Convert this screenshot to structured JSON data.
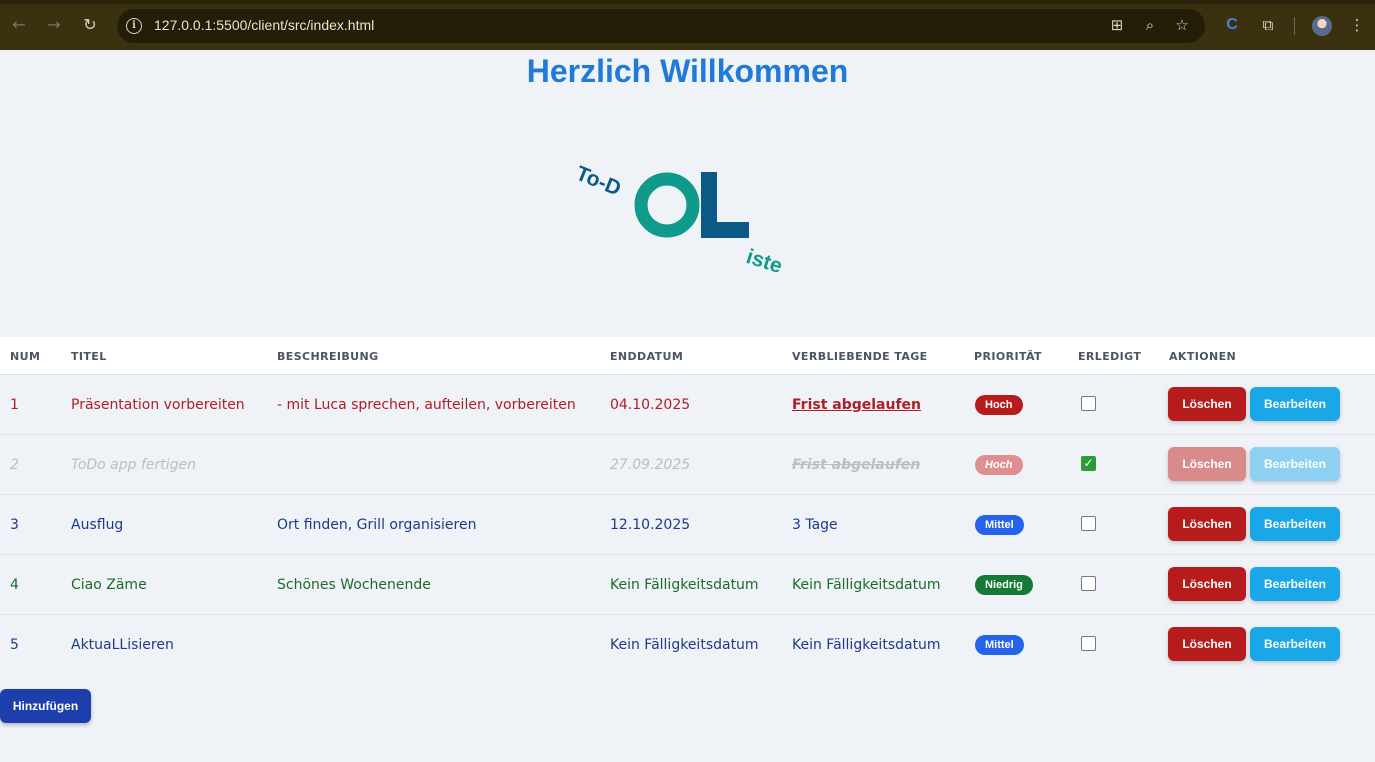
{
  "browser": {
    "url": "127.0.0.1:5500/client/src/index.html"
  },
  "page": {
    "title": "Herzlich Willkommen",
    "logo": {
      "left_text": "To-D",
      "big_text_o": "O",
      "big_text_l": "L",
      "right_text": "iste",
      "colors": {
        "teal": "#0f9a8c",
        "navy": "#0b5a86"
      }
    }
  },
  "table": {
    "headers": {
      "num": "NUM",
      "title": "TITEL",
      "desc": "BESCHREIBUNG",
      "due": "ENDDATUM",
      "remaining": "VERBLIEBENDE TAGE",
      "priority": "PRIORITÄT",
      "done": "ERLEDIGT",
      "actions": "AKTIONEN"
    },
    "rows": [
      {
        "num": "1",
        "title": "Präsentation vorbereiten",
        "desc": "- mit Luca sprechen, aufteilen, vorbereiten",
        "due": "04.10.2025",
        "remaining": "Frist abgelaufen",
        "priority": "Hoch",
        "done": false,
        "color": "#b01e24",
        "badge_color": "#b71c1c"
      },
      {
        "num": "2",
        "title": "ToDo app fertigen",
        "desc": "",
        "due": "27.09.2025",
        "remaining": "Frist abgelaufen",
        "priority": "Hoch",
        "done": true,
        "color": "#b9bec7",
        "badge_color": "#df8f8f"
      },
      {
        "num": "3",
        "title": "Ausflug",
        "desc": "Ort finden, Grill organisieren",
        "due": "12.10.2025",
        "remaining": "3 Tage",
        "priority": "Mittel",
        "done": false,
        "color": "#1e3a8a",
        "badge_color": "#2563eb"
      },
      {
        "num": "4",
        "title": "Ciao Zäme",
        "desc": "Schönes Wochenende",
        "due": "Kein Fälligkeitsdatum",
        "remaining": "Kein Fälligkeitsdatum",
        "priority": "Niedrig",
        "done": false,
        "color": "#1c6b2a",
        "badge_color": "#157a36"
      },
      {
        "num": "5",
        "title": "AktuaLLisieren",
        "desc": "",
        "due": "Kein Fälligkeitsdatum",
        "remaining": "Kein Fälligkeitsdatum",
        "priority": "Mittel",
        "done": false,
        "color": "#1e3a8a",
        "badge_color": "#2563eb"
      }
    ],
    "delete_label": "Löschen",
    "edit_label": "Bearbeiten"
  },
  "add_label": "Hinzufügen"
}
